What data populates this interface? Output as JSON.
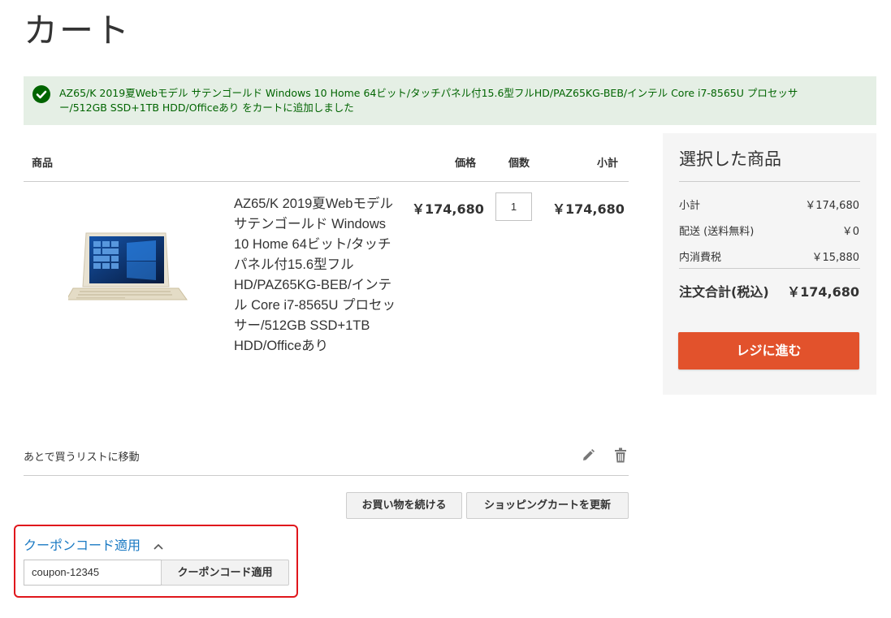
{
  "page": {
    "title": "カート"
  },
  "message": {
    "text": "AZ65/K 2019夏Webモデル サテンゴールド Windows 10 Home 64ビット/タッチパネル付15.6型フルHD/PAZ65KG-BEB/インテル Core i7-8565U プロセッサー/512GB SSD+1TB HDD/Officeあり をカートに追加しました",
    "icon": "check-circle-icon"
  },
  "table": {
    "headers": {
      "item": "商品",
      "price": "価格",
      "qty": "個数",
      "subtotal": "小計"
    }
  },
  "item": {
    "name": "AZ65/K 2019夏Webモデル サテンゴールド Windows 10 Home 64ビット/タッチパネル付15.6型フルHD/PAZ65KG-BEB/インテル Core i7-8565U プロセッサー/512GB SSD+1TB HDD/Officeあり",
    "price": "￥174,680",
    "qty": "1",
    "subtotal": "￥174,680",
    "move_to_wishlist": "あとで買うリストに移動"
  },
  "actions": {
    "continue_shopping": "お買い物を続ける",
    "update_cart": "ショッピングカートを更新"
  },
  "summary": {
    "title": "選択した商品",
    "subtotal_label": "小計",
    "subtotal_value": "￥174,680",
    "shipping_label": "配送 (送料無料)",
    "shipping_value": "￥0",
    "tax_label": "内消費税",
    "tax_value": "￥15,880",
    "total_label": "注文合計(税込)",
    "total_value": "￥174,680",
    "checkout_label": "レジに進む"
  },
  "coupon": {
    "title": "クーポンコード適用",
    "input_value": "coupon-12345",
    "button_label": "クーポンコード適用"
  },
  "colors": {
    "accent": "#e2522c",
    "link": "#1979c3",
    "success_bg": "#e5efe5",
    "success_text": "#006400",
    "highlight": "#e0161c"
  }
}
